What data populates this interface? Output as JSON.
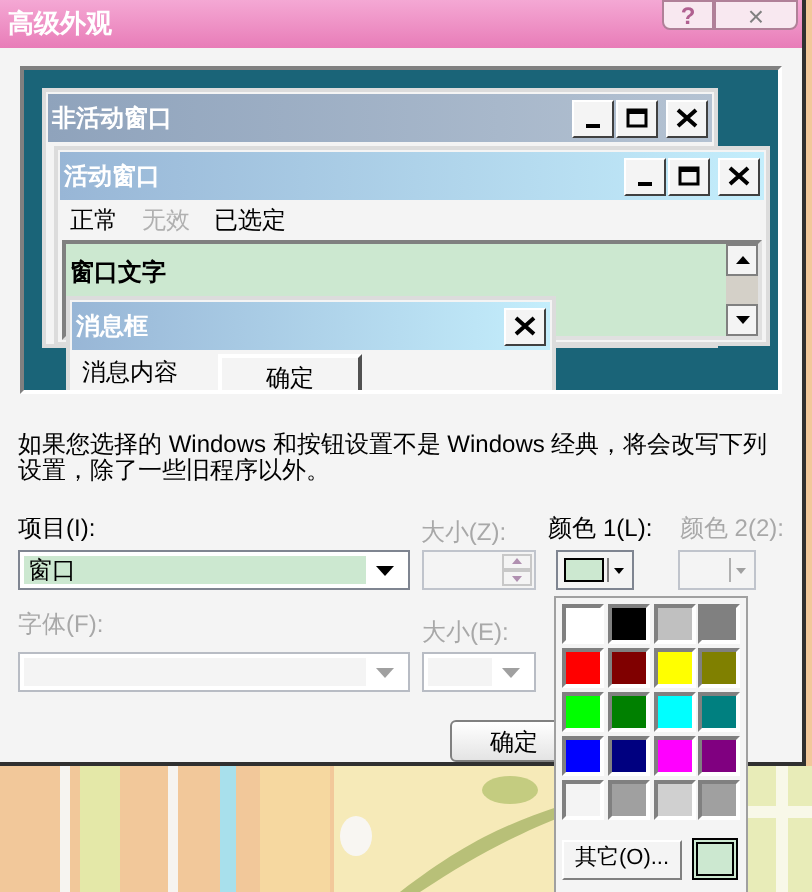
{
  "window": {
    "title": "高级外观",
    "help_button": "?",
    "close_button": "×"
  },
  "preview": {
    "inactive_window": {
      "title": "非活动窗口"
    },
    "active_window": {
      "title": "活动窗口",
      "menu": [
        {
          "label": "正常",
          "disabled": false
        },
        {
          "label": "无效",
          "disabled": true
        },
        {
          "label": "已选定",
          "disabled": false
        }
      ],
      "window_text": "窗口文字"
    },
    "message_box": {
      "title": "消息框",
      "message": "消息内容",
      "button": "确定"
    }
  },
  "description": "如果您选择的 Windows 和按钮设置不是 Windows 经典，将会改写下列设置，除了一些旧程序以外。",
  "item": {
    "label": "项目(I):",
    "value": "窗口"
  },
  "size_1": {
    "label": "大小(Z):",
    "disabled": true
  },
  "color_1": {
    "label": "颜色 1(L):",
    "color": "#cce8d0",
    "disabled": false
  },
  "color_2": {
    "label": "颜色 2(2):",
    "disabled": true
  },
  "font": {
    "label": "字体(F):",
    "disabled": true
  },
  "size_2": {
    "label": "大小(E):",
    "disabled": true
  },
  "buttons": [
    "确定"
  ],
  "color_popup": {
    "swatches": [
      {
        "color": "#ffffff"
      },
      {
        "color": "#000000"
      },
      {
        "color": "#c0c0c0"
      },
      {
        "color": "#808080"
      },
      {
        "color": "#ff0000"
      },
      {
        "color": "#800000"
      },
      {
        "color": "#ffff00"
      },
      {
        "color": "#808000"
      },
      {
        "color": "#00ff00"
      },
      {
        "color": "#008000"
      },
      {
        "color": "#00ffff"
      },
      {
        "color": "#008080"
      },
      {
        "color": "#0000ff"
      },
      {
        "color": "#000080"
      },
      {
        "color": "#ff00ff"
      },
      {
        "color": "#800080"
      },
      {
        "color": "#f4f4f4"
      },
      {
        "color": "#a0a0a0"
      },
      {
        "color": "#d0d0d0"
      },
      {
        "color": "#a0a0a0"
      }
    ],
    "other_button": "其它(O)...",
    "current": {
      "color": "#cce8d0"
    }
  }
}
